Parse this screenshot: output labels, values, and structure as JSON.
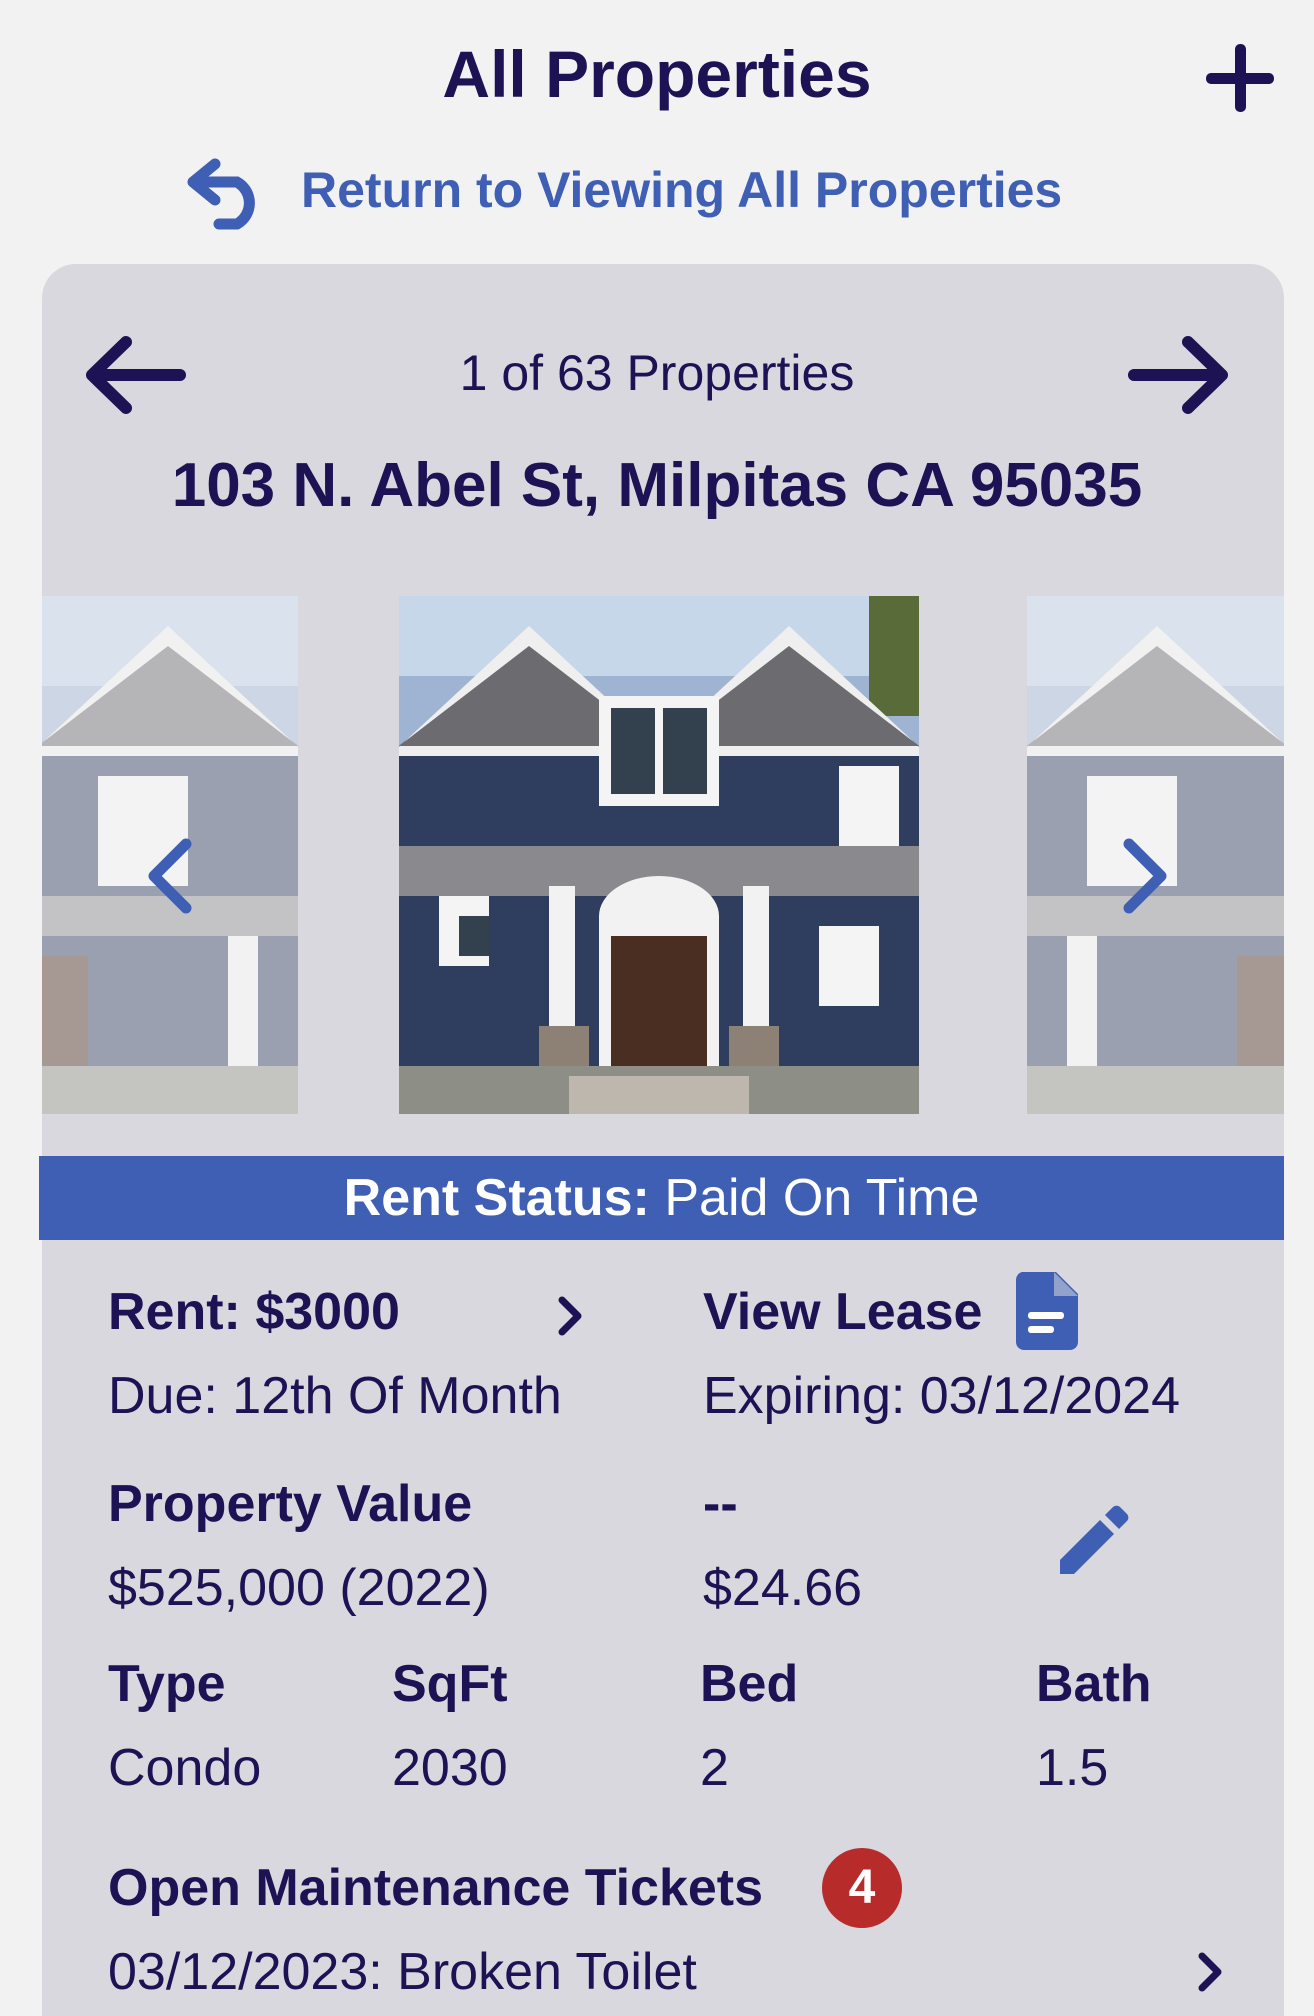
{
  "header": {
    "title": "All Properties",
    "add_icon": "plus-icon",
    "return_label": "Return to Viewing All Properties",
    "return_icon": "undo-arrow-icon"
  },
  "property": {
    "counter": "1 of 63 Properties",
    "address": "103 N. Abel St, Milpitas CA 95035",
    "rent_status_label": "Rent Status:",
    "rent_status_value": " Paid On Time",
    "rent": "Rent: $3000",
    "due": "Due: 12th Of Month",
    "view_lease": "View Lease",
    "expiring": "Expiring: 03/12/2024",
    "property_value_label": "Property Value",
    "property_value": "$525,000 (2022)",
    "secondary_label": "--",
    "secondary_value": "$24.66",
    "type_label": "Type",
    "type_value": "Condo",
    "sqft_label": "SqFt",
    "sqft_value": "2030",
    "bed_label": "Bed",
    "bed_value": "2",
    "bath_label": "Bath",
    "bath_value": "1.5",
    "tickets_label": "Open Maintenance Tickets",
    "tickets_count": "4",
    "ticket_first": "03/12/2023: Broken Toilet"
  },
  "colors": {
    "primary_navy": "#1c1254",
    "accent_blue": "#3e5fb3",
    "badge_red": "#b82b2b",
    "card_bg": "#d9d8de"
  }
}
